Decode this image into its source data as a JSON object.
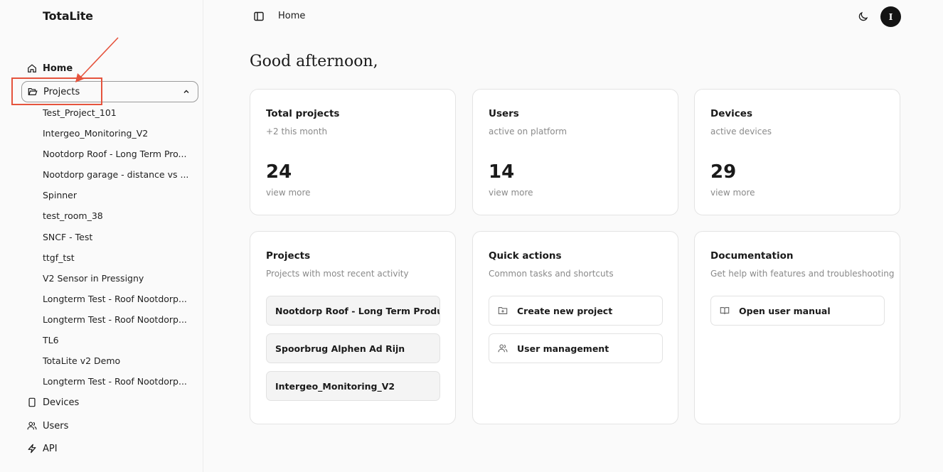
{
  "app": {
    "brand": "TotaLite"
  },
  "sidebar": {
    "home_label": "Home",
    "projects_label": "Projects",
    "projects": [
      "Test_Project_101",
      "Intergeo_Monitoring_V2",
      "Nootdorp Roof - Long Term Pro...",
      "Nootdorp garage - distance vs ...",
      "Spinner",
      "test_room_38",
      "SNCF - Test",
      "ttgf_tst",
      "V2 Sensor in Pressigny",
      "Longterm Test - Roof Nootdorp...",
      "Longterm Test - Roof Nootdorp...",
      "TL6",
      "TotaLite v2 Demo",
      "Longterm Test - Roof Nootdorp..."
    ],
    "devices_label": "Devices",
    "users_label": "Users",
    "api_label": "API"
  },
  "topbar": {
    "title": "Home",
    "avatar_initial": "I"
  },
  "main": {
    "greeting": "Good afternoon,",
    "stats": [
      {
        "title": "Total projects",
        "subtitle": "+2 this month",
        "value": "24",
        "link": "view more"
      },
      {
        "title": "Users",
        "subtitle": "active on platform",
        "value": "14",
        "link": "view more"
      },
      {
        "title": "Devices",
        "subtitle": "active devices",
        "value": "29",
        "link": "view more"
      }
    ],
    "projects_card": {
      "title": "Projects",
      "subtitle": "Projects with most recent activity",
      "items": [
        "Nootdorp Roof - Long Term Producti...",
        "Spoorbrug Alphen Ad Rijn",
        "Intergeo_Monitoring_V2"
      ]
    },
    "quick_actions": {
      "title": "Quick actions",
      "subtitle": "Common tasks and shortcuts",
      "create_label": "Create new project",
      "users_label": "User management"
    },
    "documentation": {
      "title": "Documentation",
      "subtitle": "Get help with features and troubleshooting",
      "manual_label": "Open user manual"
    }
  },
  "colors": {
    "annotation": "#e5533d",
    "avatar_bg": "#141414",
    "muted_text": "#8a8a8a"
  }
}
